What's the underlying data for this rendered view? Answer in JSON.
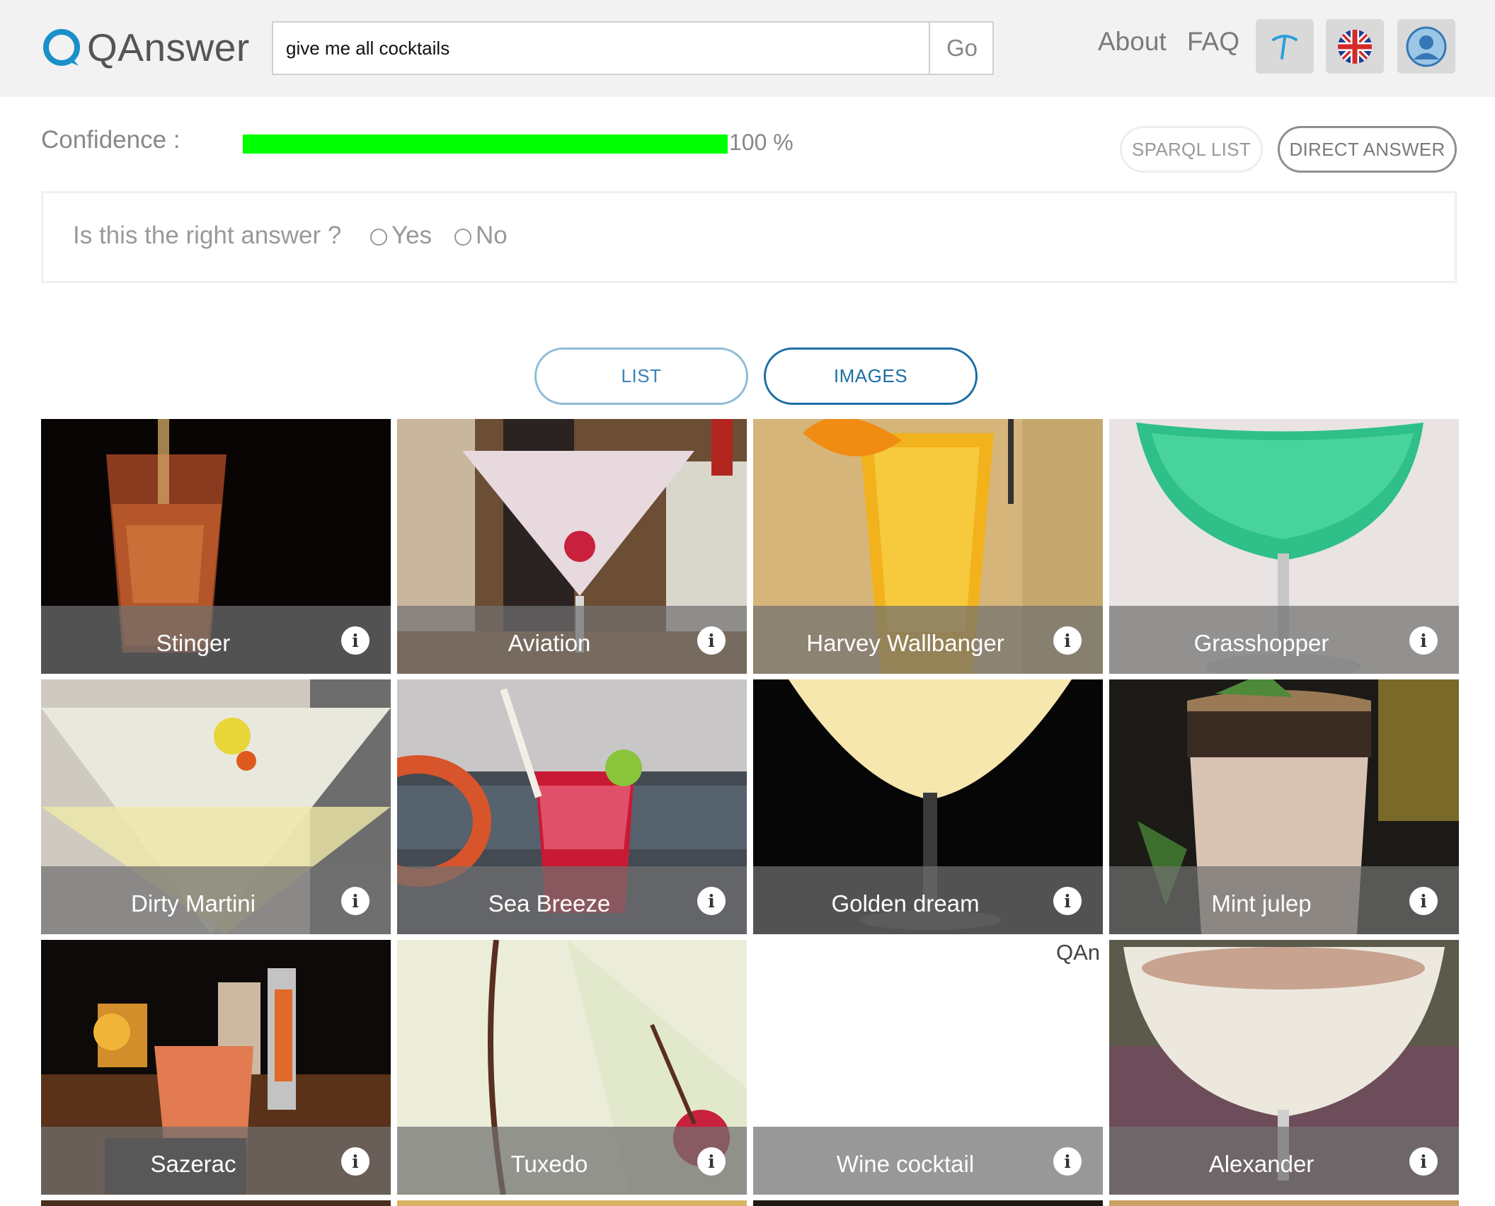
{
  "header": {
    "logo_text": "QAnswer",
    "search": {
      "value": "give me all cocktails",
      "placeholder": ""
    },
    "go_label": "Go",
    "nav": {
      "about": "About",
      "faq": "FAQ"
    },
    "icons": [
      "tool-icon",
      "uk-flag-icon",
      "user-icon"
    ]
  },
  "confidence": {
    "label": "Confidence :",
    "percent": 100,
    "value_text": "100 %",
    "bar_color": "#00ff00"
  },
  "buttons": {
    "sparql_list": "SPARQL LIST",
    "direct_answer": "DIRECT ANSWER"
  },
  "feedback": {
    "question": "Is this the right answer ?",
    "yes": "Yes",
    "no": "No"
  },
  "view_tabs": {
    "list": "LIST",
    "images": "IMAGES",
    "active": "IMAGES"
  },
  "results": [
    {
      "name": "Stinger"
    },
    {
      "name": "Aviation"
    },
    {
      "name": "Harvey Wallbanger"
    },
    {
      "name": "Grasshopper"
    },
    {
      "name": "Dirty Martini"
    },
    {
      "name": "Sea Breeze"
    },
    {
      "name": "Golden dream"
    },
    {
      "name": "Mint julep"
    },
    {
      "name": "Sazerac"
    },
    {
      "name": "Tuxedo"
    },
    {
      "name": "Wine cocktail",
      "image_alt": "QAn"
    },
    {
      "name": "Alexander"
    }
  ],
  "colors": {
    "accent": "#1c6ea4",
    "logo": "#1a8fc9",
    "header_bg": "#f2f2f2"
  }
}
